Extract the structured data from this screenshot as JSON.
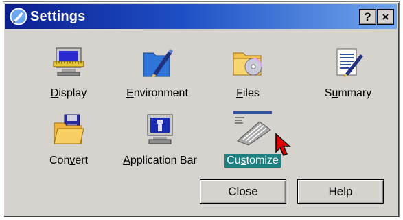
{
  "window": {
    "title": "Settings",
    "help_button": "?",
    "close_button": "×"
  },
  "icons": [
    {
      "id": "display",
      "label": "Display",
      "underline": "D",
      "rest": "isplay",
      "icon": "monitor-ruler-icon"
    },
    {
      "id": "environment",
      "label": "Environment",
      "underline": "E",
      "rest": "nvironment",
      "icon": "blue-folder-pen-icon"
    },
    {
      "id": "files",
      "label": "Files",
      "underline": "F",
      "rest": "iles",
      "icon": "folder-cd-icon"
    },
    {
      "id": "summary",
      "label": "Summary",
      "underline": "u",
      "pre": "S",
      "rest": "mmary",
      "icon": "document-pen-icon"
    },
    {
      "id": "convert",
      "label": "Convert",
      "underline": "v",
      "pre": "Con",
      "rest": "ert",
      "icon": "folder-floppy-icon"
    },
    {
      "id": "appbar",
      "label": "Application Bar",
      "underline": "A",
      "rest": "pplication Bar",
      "icon": "monitor-info-icon"
    },
    {
      "id": "customize",
      "label": "Customize",
      "underline": "s",
      "pre": "Cu",
      "rest": "tomize",
      "icon": "keyboard-icon",
      "selected": true
    }
  ],
  "buttons": {
    "close_label": "Close",
    "help_label": "Help"
  }
}
